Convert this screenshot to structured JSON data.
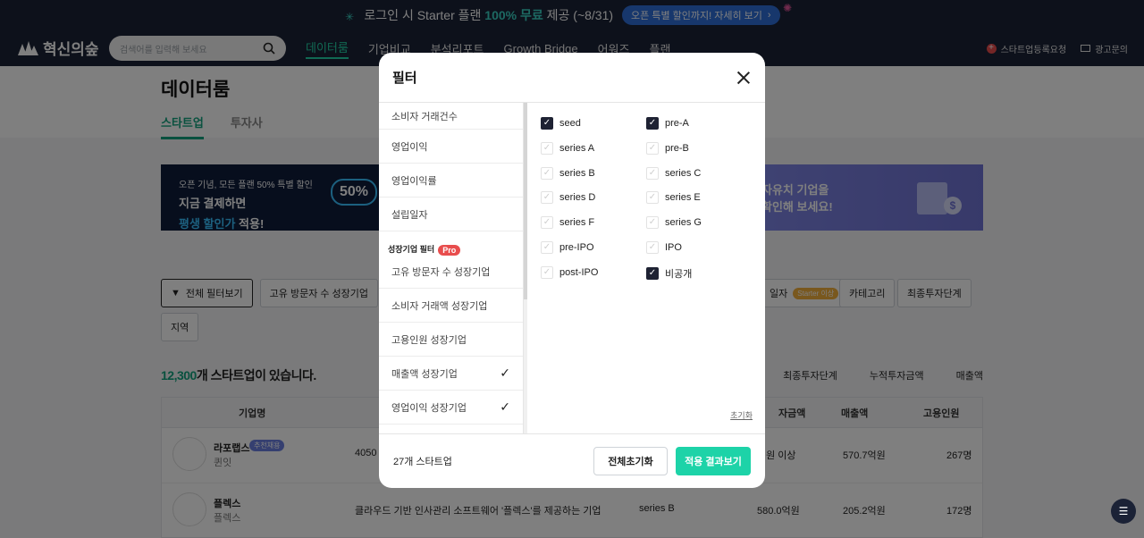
{
  "promo": {
    "text_prefix": "로그인 시 Starter 플랜",
    "text_highlight": "100% 무료",
    "text_suffix": "제공 (~8/31)",
    "button_label": "오픈 특별 할인까지! 자세히 보기"
  },
  "nav": {
    "logo": "혁신의숲",
    "search_placeholder": "검색어를 입력해 보세요",
    "menu": [
      "데이터룸",
      "기업비교",
      "분석리포트",
      "Growth Bridge",
      "어워즈",
      "플랜"
    ],
    "right": [
      "스타트업등록요청",
      "광고문의"
    ]
  },
  "page": {
    "title": "데이터룸",
    "tabs": [
      "스타트업",
      "투자사"
    ],
    "banner_left": {
      "line1": "오픈 기념, 모든 플랜 50% 특별 할인",
      "line2": "지금 결제하면",
      "line3_hl": "평생 할인가",
      "line3": "적용!",
      "badge": "50%"
    },
    "banner_right": {
      "line1": "자유치 기업을",
      "line2": "확인해 보세요!"
    },
    "filter_button": "전체 필터보기",
    "chips": [
      "고유 방문자 수 성장기업"
    ],
    "chips_right": [
      "일자",
      "카테고리",
      "최종투자단계"
    ],
    "starter_badge": "Starter 이상",
    "region_chip": "지역",
    "count_num": "12,300",
    "count_text": "개 스타트업이 있습니다.",
    "sorts": [
      "최종투자단계",
      "누적투자금액",
      "매출액"
    ],
    "table_headers": [
      "기업명",
      "자금액",
      "매출액",
      "고용인원"
    ],
    "rows": [
      {
        "name": "라포랩스",
        "badge": "추천채용",
        "sub": "퀸잇",
        "desc": "4050",
        "fund": "억원 이상",
        "revenue": "570.7억원",
        "staff": "267명"
      },
      {
        "name": "플렉스",
        "sub": "플렉스",
        "desc": "클라우드 기반 인사관리 소프트웨어 '플렉스'를 제공하는 기업",
        "stage": "series B",
        "fund": "580.0억원",
        "revenue": "205.2억원",
        "staff": "172명"
      }
    ]
  },
  "modal": {
    "title": "필터",
    "left_items_top": [
      "소비자 거래건수",
      "영업이익",
      "영업이익률",
      "설립일자"
    ],
    "group_label": "성장기업 필터",
    "pro_badge": "Pro",
    "left_items_growth": [
      {
        "label": "고유 방문자 수 성장기업",
        "checked": false
      },
      {
        "label": "소비자 거래액 성장기업",
        "checked": false
      },
      {
        "label": "고용인원 성장기업",
        "checked": false
      },
      {
        "label": "매출액 성장기업",
        "checked": true
      },
      {
        "label": "영업이익 성장기업",
        "checked": true
      }
    ],
    "options": [
      {
        "label": "seed",
        "checked": true
      },
      {
        "label": "pre-A",
        "checked": true
      },
      {
        "label": "series A",
        "checked": false
      },
      {
        "label": "pre-B",
        "checked": false
      },
      {
        "label": "series B",
        "checked": false
      },
      {
        "label": "series C",
        "checked": false
      },
      {
        "label": "series D",
        "checked": false
      },
      {
        "label": "series E",
        "checked": false
      },
      {
        "label": "series F",
        "checked": false
      },
      {
        "label": "series G",
        "checked": false
      },
      {
        "label": "pre-IPO",
        "checked": false
      },
      {
        "label": "IPO",
        "checked": false
      },
      {
        "label": "post-IPO",
        "checked": false
      },
      {
        "label": "비공개",
        "checked": true
      }
    ],
    "reset_small": "초기화",
    "result_count": "27개 스타트업",
    "reset_all_button": "전체초기화",
    "apply_button": "적용 결과보기"
  },
  "colors": {
    "accent": "#1dd3a8",
    "nav_bg": "#1b2236",
    "checked_box": "#1e2233",
    "pro_badge": "#e84d4d"
  }
}
